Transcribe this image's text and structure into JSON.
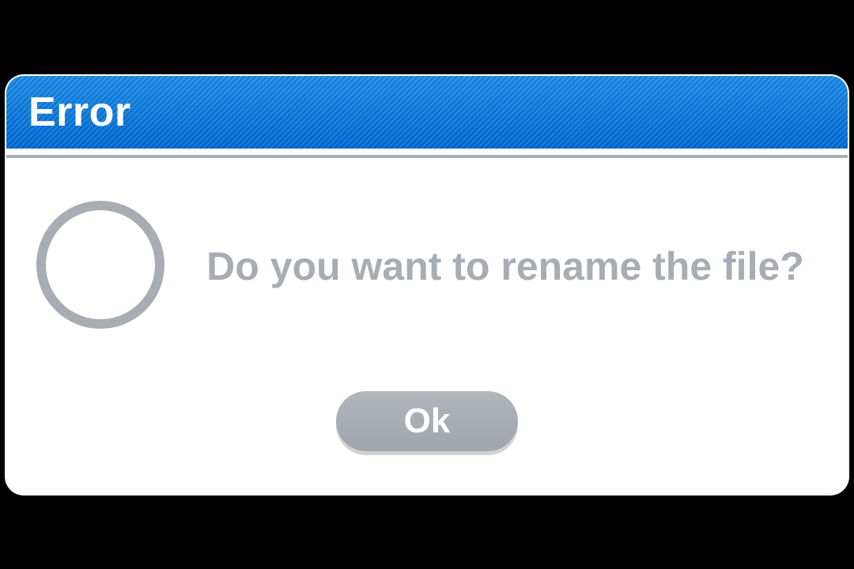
{
  "dialog": {
    "title": "Error",
    "message": "Do you want to rename the file?",
    "ok_label": "Ok"
  }
}
